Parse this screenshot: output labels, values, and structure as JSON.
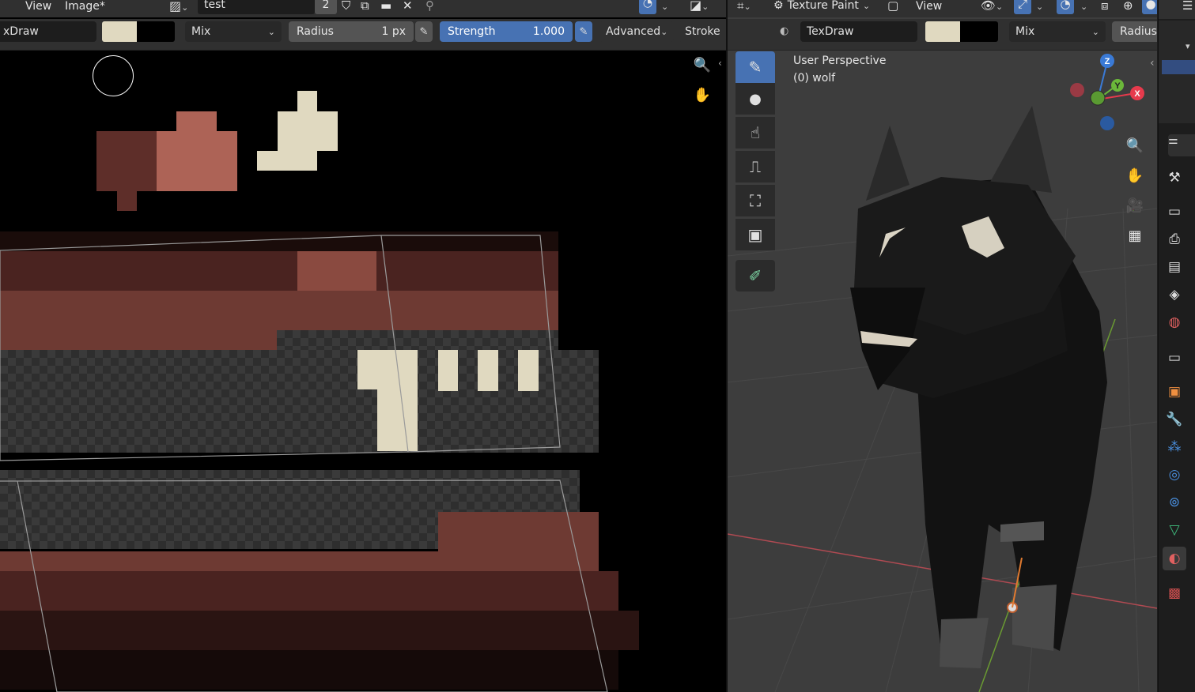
{
  "image_editor": {
    "menu": {
      "view": "View",
      "image": "Image*"
    },
    "image_name": "test",
    "users_count": "2",
    "tool_settings": {
      "brush_name": "xDraw",
      "blend_mode": "Mix",
      "radius_label": "Radius",
      "radius_value": "1 px",
      "strength_label": "Strength",
      "strength_value": "1.000",
      "advanced": "Advanced",
      "stroke": "Stroke"
    },
    "colors": {
      "primary": "#e0d9c0",
      "secondary": "#000000"
    }
  },
  "viewport": {
    "mode": "Texture Paint",
    "menu_view": "View",
    "tool_settings": {
      "brush_name": "TexDraw",
      "blend_mode": "Mix",
      "radius_label": "Radius"
    },
    "overlay_text": {
      "perspective": "User Perspective",
      "object": "(0) wolf"
    },
    "gizmo": {
      "x": "X",
      "y": "Y",
      "z": "Z"
    },
    "colors": {
      "x_axis": "#e63a4c",
      "y_axis": "#6bb83a",
      "z_axis": "#3a7ad6"
    }
  },
  "toolbar": {
    "tools": [
      {
        "name": "draw-tool",
        "glyph": "✎",
        "active": true
      },
      {
        "name": "soften-tool",
        "glyph": "💧",
        "active": false
      },
      {
        "name": "smear-tool",
        "glyph": "☝",
        "active": false
      },
      {
        "name": "clone-tool",
        "glyph": "⎍",
        "active": false
      },
      {
        "name": "fill-tool",
        "glyph": "⛶",
        "active": false
      },
      {
        "name": "mask-tool",
        "glyph": "▣",
        "active": false
      },
      {
        "name": "annotate-tool",
        "glyph": "✐",
        "active": false
      }
    ]
  },
  "accent": "#4772b3"
}
